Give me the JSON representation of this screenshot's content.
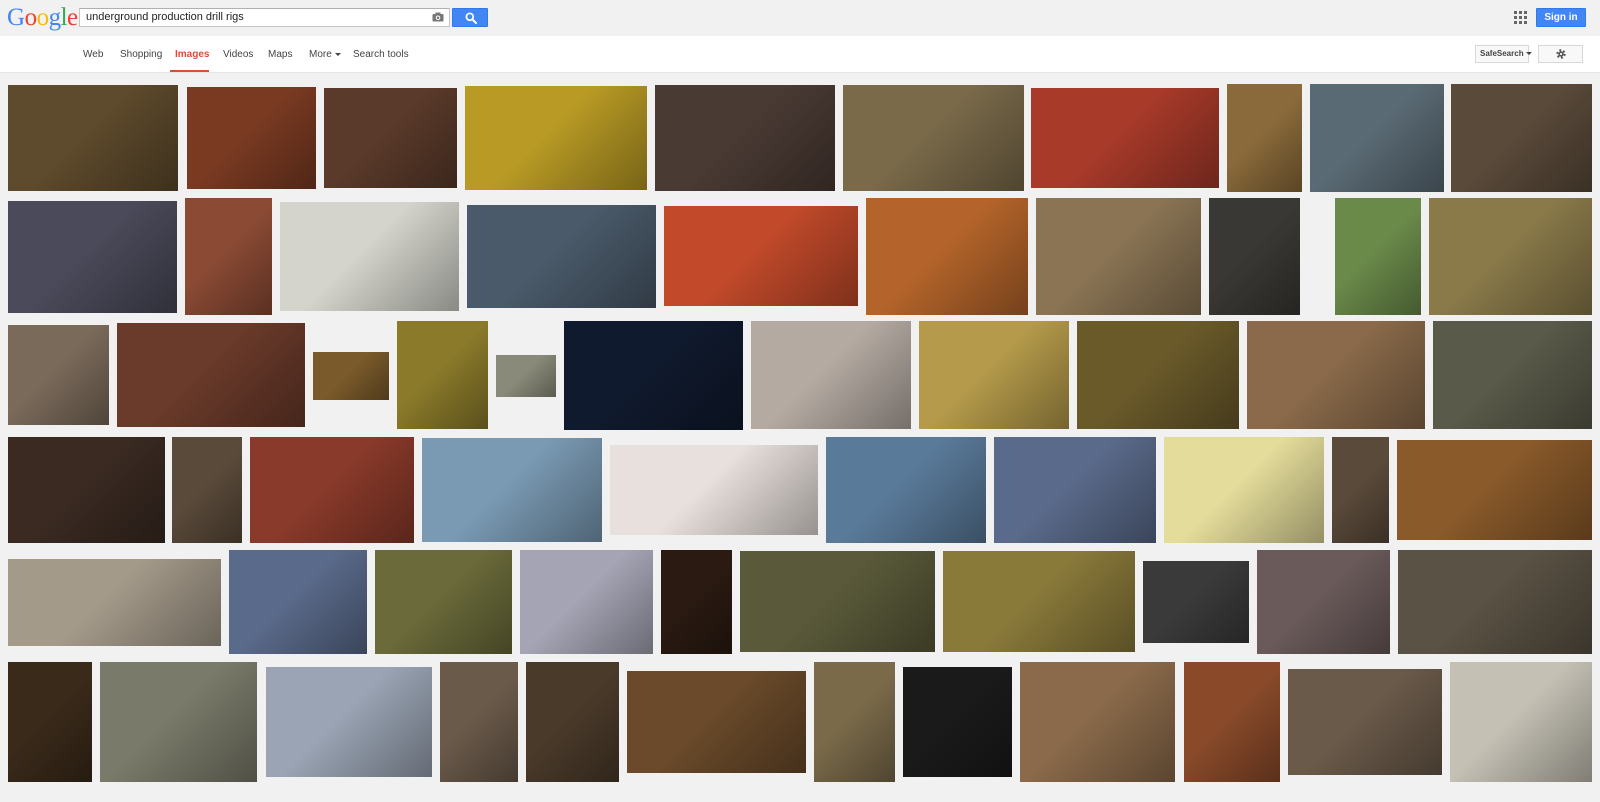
{
  "logo": {
    "letters": [
      "G",
      "o",
      "o",
      "g",
      "l",
      "e"
    ]
  },
  "search": {
    "query": "underground production drill rigs"
  },
  "header": {
    "signin_label": "Sign in"
  },
  "nav": {
    "items": [
      {
        "label": "Web"
      },
      {
        "label": "Shopping"
      },
      {
        "label": "Images"
      },
      {
        "label": "Videos"
      },
      {
        "label": "Maps"
      },
      {
        "label": "More"
      },
      {
        "label": "Search tools"
      }
    ],
    "active": "Images",
    "safesearch_label": "SafeSearch"
  },
  "colors": {
    "google_blue": "#4285f4",
    "google_red": "#dd4b39"
  },
  "results": {
    "rows": [
      [
        "#5e4a2c",
        "#7a3a22",
        "#5a3a2a",
        "#b89a24",
        "#4a3a34",
        "#7a6a4a",
        "#a83a2a",
        "#8a6a3a",
        "#5a6a74",
        "#5a4a3a"
      ],
      [
        "#4a4a5a",
        "#8a4a34",
        "#d4d4cc",
        "#4a5a6a",
        "#c24a2a",
        "#b4642a",
        "#8a7454",
        "#3a3834",
        "#6a8a4a",
        "#8a7a4a"
      ],
      [
        "#7a6a5a",
        "#6a3a2a",
        "#7a5a2a",
        "#8a7a2a",
        "#8a8a7a",
        "#101a2e",
        "#b4aaa2",
        "#b49a4a",
        "#6a5a2a",
        "#8a6a4a",
        "#5a5a4a"
      ],
      [
        "#3a2a22",
        "#5a4a3a",
        "#8a3a2a",
        "#7a9ab4",
        "#e8e0dc",
        "#5a7a9a",
        "#5a6a8a",
        "#e4dc9a",
        "#5a4a3a",
        "#8a5a2a"
      ],
      [
        "#a49a8a",
        "#5a6a8a",
        "#6a6a3a",
        "#a4a4b4",
        "#2a1a12",
        "#5a5a3a",
        "#8a7a3a",
        "#3a3a3a",
        "#6a5a5a",
        "#5a5244"
      ],
      [
        "#3a2a1a",
        "#7a7a6a",
        "#9aa4b4",
        "#6a5a4a",
        "#4a3a2a",
        "#6a4a2a",
        "#7a6a4a",
        "#1a1a1a",
        "#8a6a4a",
        "#8a4a2a",
        "#6a5a4a",
        "#c4c0b4"
      ]
    ]
  }
}
